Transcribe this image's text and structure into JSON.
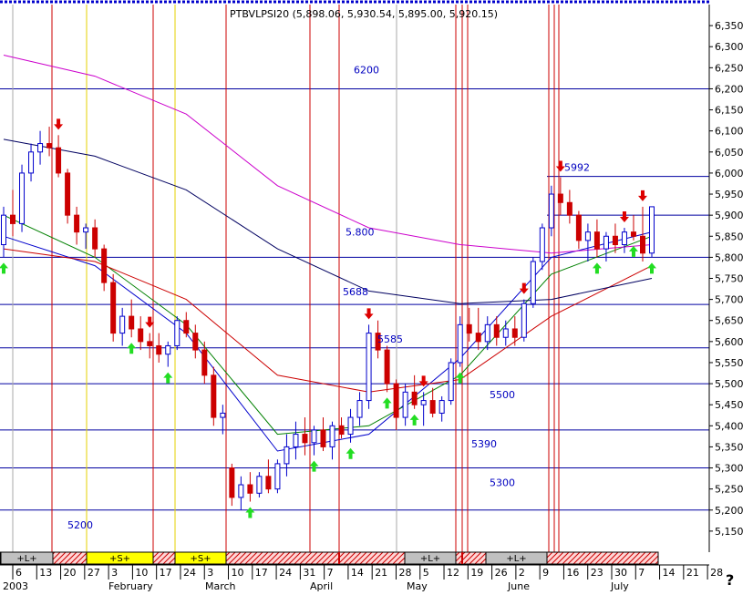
{
  "chart_data": {
    "type": "candlestick",
    "instrument": "PTBVLPSI20",
    "quote": "PTBVLPSI20 (5,898.06, 5,930.54, 5,895.00, 5,920.15)",
    "ylim": [
      5100,
      6400
    ],
    "y_ticks": [
      5150,
      5200,
      5250,
      5300,
      5350,
      5400,
      5450,
      5500,
      5550,
      5600,
      5650,
      5700,
      5750,
      5800,
      5850,
      5900,
      5950,
      6000,
      6050,
      6100,
      6150,
      6200,
      6250,
      6300,
      6350
    ],
    "x_tick_labels": [
      "6",
      "13",
      "20",
      "27",
      "3",
      "10",
      "17",
      "24",
      "3",
      "10",
      "17",
      "24",
      "31",
      "7",
      "14",
      "21",
      "28",
      "5",
      "12",
      "19",
      "26",
      "2",
      "9",
      "16",
      "23",
      "30",
      "7",
      "14",
      "21",
      "28"
    ],
    "month_labels": [
      "2003",
      "February",
      "March",
      "April",
      "May",
      "June",
      "July"
    ],
    "x_axis_note": "2003",
    "corner_mark": "?",
    "levels": [
      {
        "value": 6200,
        "label": "6200"
      },
      {
        "value": 5992,
        "label": "5992"
      },
      {
        "value": 5800,
        "label": "5.800"
      },
      {
        "value": 5688,
        "label": "5688"
      },
      {
        "value": 5585,
        "label": "5585"
      },
      {
        "value": 5500,
        "label": "5500"
      },
      {
        "value": 5390,
        "label": "5390"
      },
      {
        "value": 5300,
        "label": "5300"
      },
      {
        "value": 5200,
        "label": "5200"
      }
    ],
    "extra_lines": [
      5900
    ],
    "signal_bands": [
      {
        "label": "+L+",
        "type": "long"
      },
      {
        "label": "+S+",
        "type": "short"
      },
      {
        "label": "+S+",
        "type": "short"
      },
      {
        "label": "+L+",
        "type": "long"
      },
      {
        "label": "+L+",
        "type": "long"
      }
    ],
    "candles": [
      [
        5830,
        5920,
        5800,
        5900
      ],
      [
        5900,
        5960,
        5850,
        5880
      ],
      [
        5880,
        6020,
        5860,
        6000
      ],
      [
        6000,
        6070,
        5980,
        6050
      ],
      [
        6050,
        6100,
        6020,
        6070
      ],
      [
        6070,
        6110,
        6040,
        6060
      ],
      [
        6060,
        6090,
        5990,
        6000
      ],
      [
        6000,
        6010,
        5880,
        5900
      ],
      [
        5900,
        5920,
        5830,
        5860
      ],
      [
        5860,
        5880,
        5820,
        5870
      ],
      [
        5870,
        5890,
        5800,
        5820
      ],
      [
        5820,
        5830,
        5720,
        5740
      ],
      [
        5740,
        5760,
        5600,
        5620
      ],
      [
        5620,
        5680,
        5590,
        5660
      ],
      [
        5660,
        5700,
        5610,
        5630
      ],
      [
        5630,
        5660,
        5580,
        5600
      ],
      [
        5600,
        5620,
        5560,
        5590
      ],
      [
        5590,
        5620,
        5550,
        5570
      ],
      [
        5570,
        5600,
        5540,
        5590
      ],
      [
        5590,
        5660,
        5580,
        5650
      ],
      [
        5650,
        5670,
        5610,
        5620
      ],
      [
        5620,
        5640,
        5560,
        5580
      ],
      [
        5580,
        5600,
        5500,
        5520
      ],
      [
        5520,
        5540,
        5400,
        5420
      ],
      [
        5420,
        5450,
        5380,
        5430
      ],
      [
        5300,
        5310,
        5210,
        5230
      ],
      [
        5230,
        5280,
        5200,
        5260
      ],
      [
        5260,
        5290,
        5220,
        5240
      ],
      [
        5240,
        5290,
        5230,
        5280
      ],
      [
        5280,
        5320,
        5240,
        5250
      ],
      [
        5250,
        5320,
        5240,
        5310
      ],
      [
        5310,
        5380,
        5280,
        5350
      ],
      [
        5350,
        5410,
        5320,
        5380
      ],
      [
        5380,
        5420,
        5330,
        5360
      ],
      [
        5360,
        5400,
        5330,
        5390
      ],
      [
        5390,
        5420,
        5340,
        5350
      ],
      [
        5350,
        5410,
        5320,
        5400
      ],
      [
        5400,
        5420,
        5370,
        5380
      ],
      [
        5380,
        5440,
        5360,
        5420
      ],
      [
        5420,
        5480,
        5400,
        5460
      ],
      [
        5460,
        5640,
        5440,
        5620
      ],
      [
        5620,
        5650,
        5560,
        5580
      ],
      [
        5580,
        5590,
        5480,
        5500
      ],
      [
        5500,
        5510,
        5390,
        5420
      ],
      [
        5420,
        5500,
        5400,
        5480
      ],
      [
        5480,
        5520,
        5440,
        5450
      ],
      [
        5450,
        5480,
        5400,
        5460
      ],
      [
        5460,
        5490,
        5420,
        5430
      ],
      [
        5430,
        5470,
        5410,
        5460
      ],
      [
        5460,
        5560,
        5450,
        5550
      ],
      [
        5550,
        5660,
        5540,
        5640
      ],
      [
        5640,
        5680,
        5600,
        5620
      ],
      [
        5620,
        5680,
        5580,
        5600
      ],
      [
        5600,
        5660,
        5580,
        5640
      ],
      [
        5640,
        5660,
        5590,
        5610
      ],
      [
        5610,
        5650,
        5590,
        5630
      ],
      [
        5630,
        5660,
        5590,
        5610
      ],
      [
        5610,
        5700,
        5600,
        5690
      ],
      [
        5690,
        5800,
        5680,
        5790
      ],
      [
        5790,
        5880,
        5770,
        5870
      ],
      [
        5870,
        5970,
        5850,
        5950
      ],
      [
        5950,
        5990,
        5900,
        5930
      ],
      [
        5930,
        5960,
        5880,
        5900
      ],
      [
        5900,
        5910,
        5820,
        5840
      ],
      [
        5840,
        5880,
        5790,
        5860
      ],
      [
        5860,
        5890,
        5800,
        5820
      ],
      [
        5820,
        5860,
        5790,
        5850
      ],
      [
        5850,
        5880,
        5810,
        5830
      ],
      [
        5830,
        5870,
        5810,
        5860
      ],
      [
        5860,
        5900,
        5840,
        5850
      ],
      [
        5850,
        5920,
        5790,
        5810
      ],
      [
        5810,
        5900,
        5800,
        5920
      ]
    ],
    "series": [
      {
        "name": "",
        "color": "#0000cc",
        "values": [
          [
            0,
            5850
          ],
          [
            10,
            5780
          ],
          [
            20,
            5620
          ],
          [
            30,
            5340
          ],
          [
            40,
            5380
          ],
          [
            50,
            5560
          ],
          [
            60,
            5800
          ],
          [
            71,
            5860
          ]
        ]
      },
      {
        "name": "",
        "color": "#008000",
        "values": [
          [
            0,
            5900
          ],
          [
            10,
            5800
          ],
          [
            20,
            5640
          ],
          [
            30,
            5380
          ],
          [
            40,
            5400
          ],
          [
            50,
            5520
          ],
          [
            60,
            5760
          ],
          [
            71,
            5850
          ]
        ]
      },
      {
        "name": "",
        "color": "#cc0000",
        "values": [
          [
            0,
            5820
          ],
          [
            10,
            5790
          ],
          [
            20,
            5700
          ],
          [
            30,
            5520
          ],
          [
            40,
            5480
          ],
          [
            50,
            5510
          ],
          [
            60,
            5660
          ],
          [
            71,
            5780
          ]
        ]
      },
      {
        "name": "",
        "color": "#000060",
        "values": [
          [
            0,
            6080
          ],
          [
            10,
            6040
          ],
          [
            20,
            5960
          ],
          [
            30,
            5820
          ],
          [
            40,
            5720
          ],
          [
            50,
            5690
          ],
          [
            60,
            5700
          ],
          [
            71,
            5750
          ]
        ]
      },
      {
        "name": "",
        "color": "#cc00cc",
        "values": [
          [
            0,
            6280
          ],
          [
            10,
            6230
          ],
          [
            20,
            6140
          ],
          [
            30,
            5970
          ],
          [
            40,
            5870
          ],
          [
            50,
            5830
          ],
          [
            60,
            5810
          ],
          [
            71,
            5830
          ]
        ]
      }
    ],
    "buy_signals": [
      0,
      14,
      18,
      27,
      34,
      38,
      42,
      45,
      50,
      65,
      69,
      71
    ],
    "sell_signals": [
      6,
      16,
      40,
      46,
      57,
      61,
      68,
      70
    ]
  }
}
